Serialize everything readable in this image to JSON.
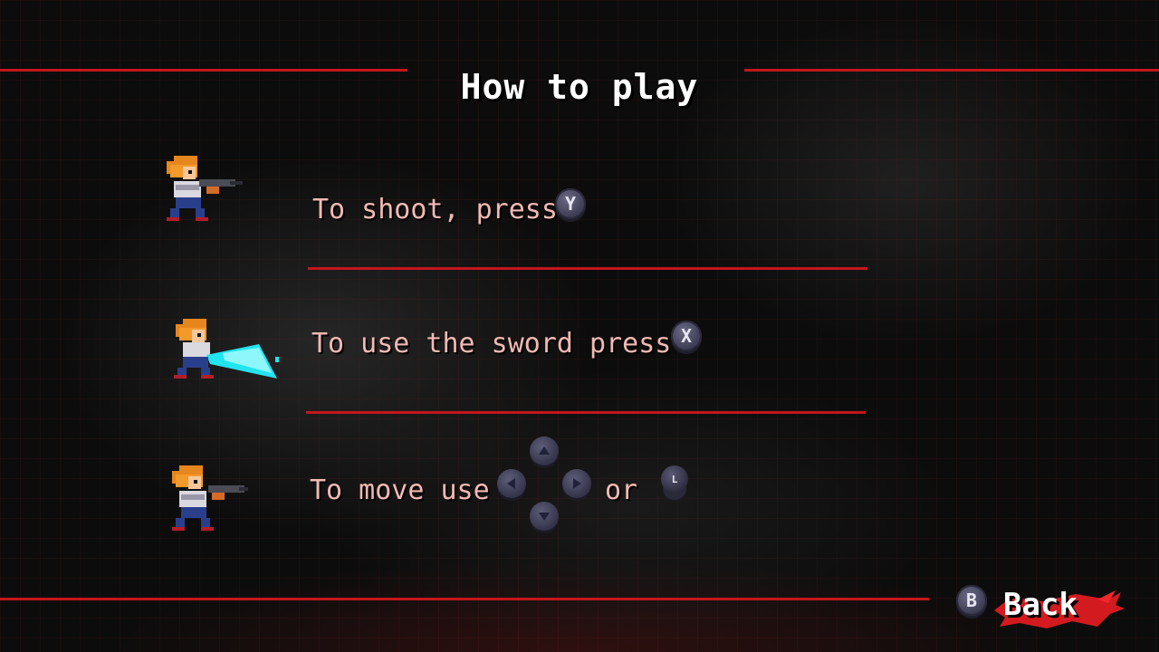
{
  "screen": {
    "title": "How to play"
  },
  "instructions": [
    {
      "text": "To shoot, press",
      "button": "Y"
    },
    {
      "text": "To use the sword press",
      "button": "X"
    },
    {
      "text": "To move use",
      "joiner": "or",
      "stick": "L"
    }
  ],
  "footer": {
    "back_button": "B",
    "back_label": "Back"
  },
  "icons": {
    "dpad": [
      "dpad-up-icon",
      "dpad-left-icon",
      "dpad-right-icon",
      "dpad-down-icon"
    ],
    "sprites": [
      "character-shooting-icon",
      "character-sword-icon",
      "character-moving-icon"
    ]
  },
  "colors": {
    "accent_red": "#c4161c",
    "instruction_text": "#f2b9b3",
    "sword_blade": "#22e4f0"
  }
}
